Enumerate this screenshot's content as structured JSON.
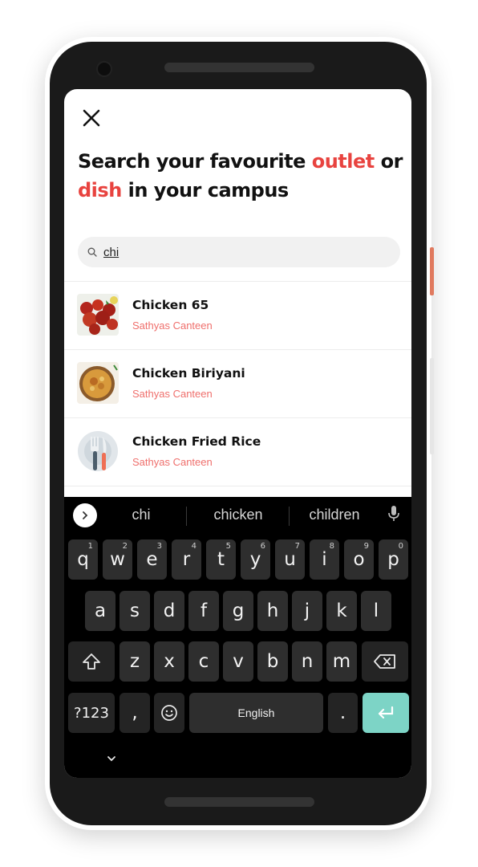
{
  "heading": {
    "part1": "Search your favourite ",
    "accent1": "outlet",
    "part2": " or ",
    "accent2": "dish",
    "part3": " in your campus"
  },
  "search": {
    "value": "chi"
  },
  "results": [
    {
      "name": "Chicken 65",
      "outlet": "Sathyas Canteen",
      "thumb": "chicken-65-image"
    },
    {
      "name": "Chicken Biriyani",
      "outlet": "Sathyas Canteen",
      "thumb": "biriyani-image"
    },
    {
      "name": "Chicken Fried Rice",
      "outlet": "Sathyas Canteen",
      "thumb": "cutlery-placeholder-icon"
    }
  ],
  "keyboard": {
    "suggestions": [
      "chi",
      "chicken",
      "children"
    ],
    "row1": [
      {
        "k": "q",
        "h": "1"
      },
      {
        "k": "w",
        "h": "2"
      },
      {
        "k": "e",
        "h": "3"
      },
      {
        "k": "r",
        "h": "4"
      },
      {
        "k": "t",
        "h": "5"
      },
      {
        "k": "y",
        "h": "6"
      },
      {
        "k": "u",
        "h": "7"
      },
      {
        "k": "i",
        "h": "8"
      },
      {
        "k": "o",
        "h": "9"
      },
      {
        "k": "p",
        "h": "0"
      }
    ],
    "row2": [
      "a",
      "s",
      "d",
      "f",
      "g",
      "h",
      "j",
      "k",
      "l"
    ],
    "row3": [
      "z",
      "x",
      "c",
      "v",
      "b",
      "n",
      "m"
    ],
    "symbols_label": "?123",
    "comma": ",",
    "space_label": "English",
    "period": "."
  },
  "colors": {
    "accent": "#e8433f",
    "outlet_text": "#ef6f6c",
    "enter_key": "#7dd4c6",
    "phone_button": "#e07a5f"
  }
}
